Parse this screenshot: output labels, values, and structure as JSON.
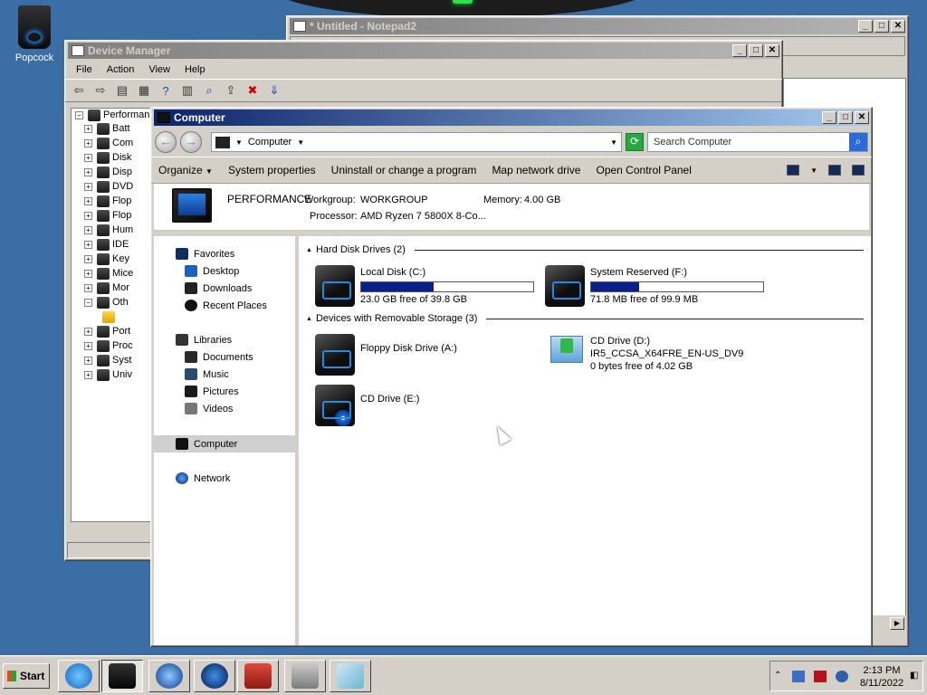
{
  "desktop": {
    "icon_label": "Popcock"
  },
  "notepad": {
    "title": "* Untitled - Notepad2"
  },
  "device_manager": {
    "title": "Device Manager",
    "menu": [
      "File",
      "Action",
      "View",
      "Help"
    ],
    "tree_root": "Performan",
    "tree_items": [
      "Batt",
      "Com",
      "Disk",
      "Disp",
      "DVD",
      "Flop",
      "Flop",
      "Hum",
      "IDE",
      "Key",
      "Mice",
      "Mor",
      "Oth",
      "",
      "Port",
      "Proc",
      "Syst",
      "Univ"
    ]
  },
  "explorer": {
    "title": "Computer",
    "address": "Computer",
    "search_placeholder": "Search Computer",
    "commands": [
      "Organize",
      "System properties",
      "Uninstall or change a program",
      "Map network drive",
      "Open Control Panel"
    ],
    "details": {
      "pc_name": "PERFORMANCE",
      "workgroup_label": "Workgroup:",
      "workgroup": "WORKGROUP",
      "memory_label": "Memory:",
      "memory": "4.00 GB",
      "processor_label": "Processor:",
      "processor": "AMD Ryzen 7 5800X 8-Co..."
    },
    "nav": {
      "favorites": "Favorites",
      "desktop": "Desktop",
      "downloads": "Downloads",
      "recent": "Recent Places",
      "libraries": "Libraries",
      "documents": "Documents",
      "music": "Music",
      "pictures": "Pictures",
      "videos": "Videos",
      "computer": "Computer",
      "network": "Network"
    },
    "groups": {
      "hdd": "Hard Disk Drives (2)",
      "removable": "Devices with Removable Storage (3)"
    },
    "drives": {
      "c": {
        "name": "Local Disk (C:)",
        "free": "23.0 GB free of 39.8 GB",
        "used_fraction": 0.42
      },
      "f": {
        "name": "System Reserved (F:)",
        "free": "71.8 MB free of 99.9 MB",
        "used_fraction": 0.28
      },
      "a": {
        "name": "Floppy Disk Drive (A:)"
      },
      "d": {
        "name": "CD Drive (D:)",
        "label": "IR5_CCSA_X64FRE_EN-US_DV9",
        "free": "0 bytes free of 4.02 GB"
      },
      "e": {
        "name": "CD Drive (E:)"
      }
    }
  },
  "taskbar": {
    "start": "Start",
    "time": "2:13 PM",
    "date": "8/11/2022"
  }
}
